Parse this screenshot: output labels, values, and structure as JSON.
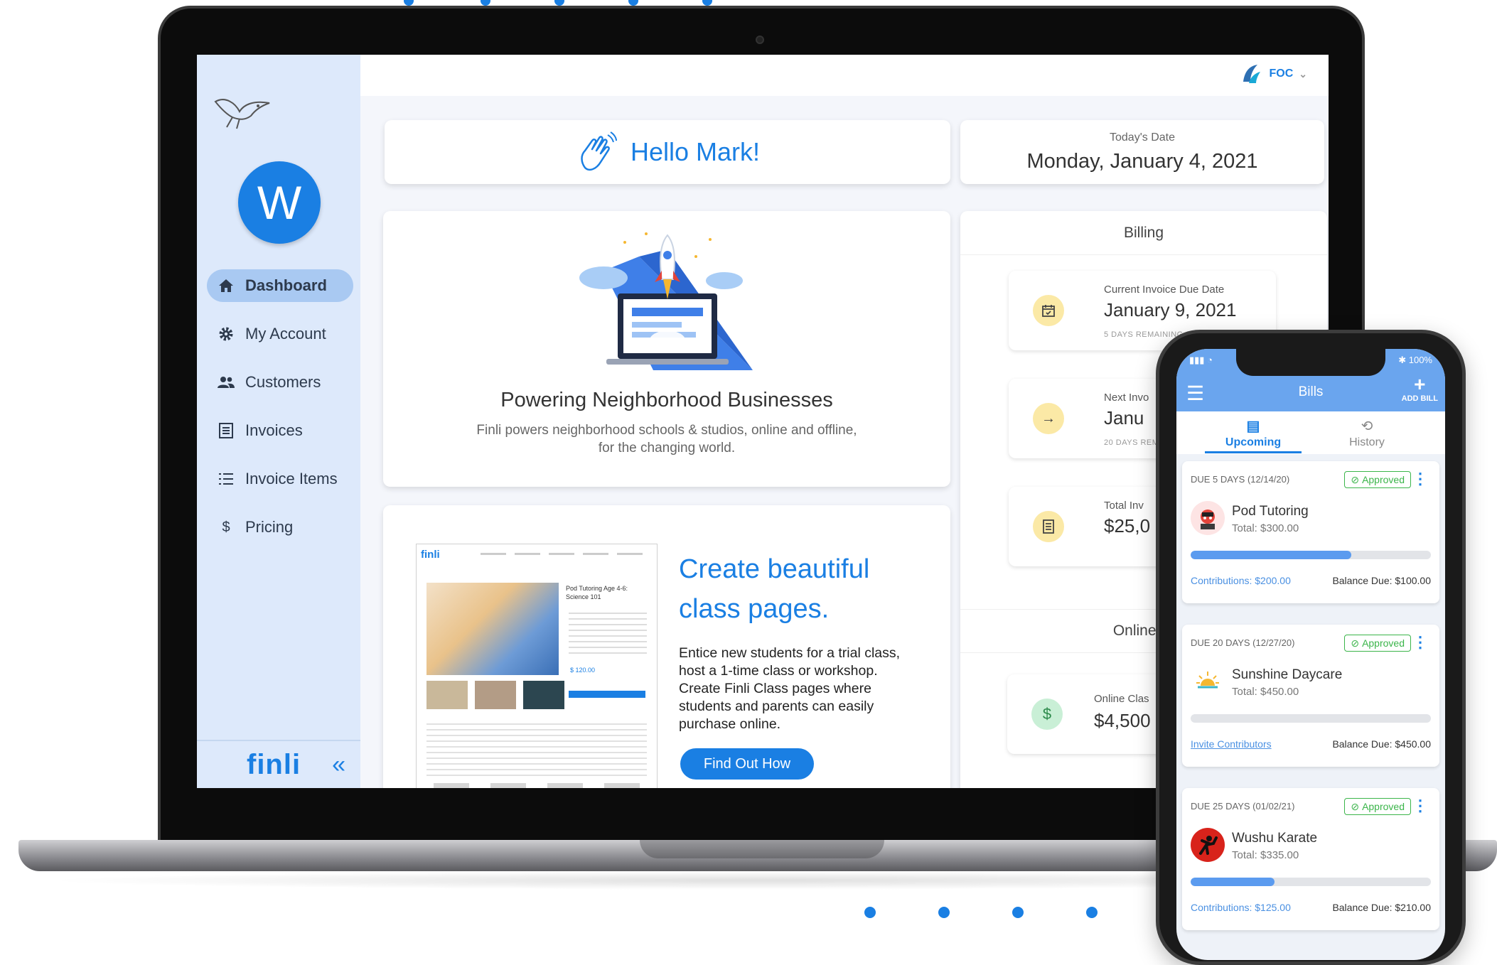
{
  "brand": {
    "sidebar_logo": "finli",
    "top_brand": "FOC"
  },
  "avatar": {
    "initial": "W"
  },
  "sidebar": {
    "items": [
      {
        "label": "Dashboard",
        "icon": "home-icon",
        "active": true
      },
      {
        "label": "My Account",
        "icon": "gear-icon"
      },
      {
        "label": "Customers",
        "icon": "people-icon"
      },
      {
        "label": "Invoices",
        "icon": "invoice-icon"
      },
      {
        "label": "Invoice Items",
        "icon": "list-icon"
      },
      {
        "label": "Pricing",
        "icon": "dollar-icon"
      }
    ],
    "collapse_icon": "double-chevron-left-icon"
  },
  "greeting": {
    "text": "Hello Mark!",
    "icon": "wave-hand-icon"
  },
  "today": {
    "label": "Today's Date",
    "value": "Monday, January 4, 2021"
  },
  "promo": {
    "title": "Powering Neighborhood Businesses",
    "desc": "Finli powers neighborhood schools & studios, online and offline, for the changing world."
  },
  "class_promo": {
    "title": "Create beautiful class pages.",
    "desc": "Entice new students for a trial class, host a 1-time class or workshop. Create Finli Class pages where students and parents can easily purchase online.",
    "button": "Find Out How",
    "mock_logo": "finli",
    "mock_class_title": "Pod Tutoring Age 4-6: Science 101",
    "mock_price": "$ 120.00"
  },
  "billing": {
    "title": "Billing",
    "items": [
      {
        "label": "Current Invoice Due Date",
        "value": "January 9, 2021",
        "note": "5 DAYS REMAINING",
        "icon": "calendar-icon"
      },
      {
        "label": "Next Invo",
        "value": "Janu",
        "note": "20 DAYS REM",
        "icon": "arrow-right-icon"
      },
      {
        "label": "Total Inv",
        "value": "$25,0",
        "note": "",
        "icon": "document-icon"
      }
    ],
    "online_title": "Online Cl",
    "online_item": {
      "label": "Online Clas",
      "value": "$4,500",
      "icon": "dollar-icon"
    }
  },
  "phone": {
    "status_left": "▮▮▮ ◔",
    "status_right": "✱ 100%",
    "title": "Bills",
    "add_label": "ADD BILL",
    "tabs": [
      {
        "label": "Upcoming",
        "icon": "list-doc-icon"
      },
      {
        "label": "History",
        "icon": "history-icon"
      }
    ],
    "bills": [
      {
        "due": "DUE 5 DAYS (12/14/20)",
        "status": "Approved",
        "name": "Pod Tutoring",
        "total": "Total: $300.00",
        "contrib": "Contributions: $200.00",
        "balance": "Balance Due: $100.00",
        "progress": 0.67
      },
      {
        "due": "DUE 20 DAYS (12/27/20)",
        "status": "Approved",
        "name": "Sunshine Daycare",
        "total": "Total: $450.00",
        "contrib": "Invite Contributors",
        "balance": "Balance Due: $450.00",
        "progress": 0
      },
      {
        "due": "DUE 25 DAYS (01/02/21)",
        "status": "Approved",
        "name": "Wushu Karate",
        "total": "Total: $335.00",
        "contrib": "Contributions: $125.00",
        "balance": "Balance Due: $210.00",
        "progress": 0.35
      }
    ]
  },
  "colors": {
    "accent": "#1a7fe3",
    "sidebar": "#dde9fb",
    "approved": "#3bb54a",
    "phone_bar": "#6aa5ee"
  }
}
